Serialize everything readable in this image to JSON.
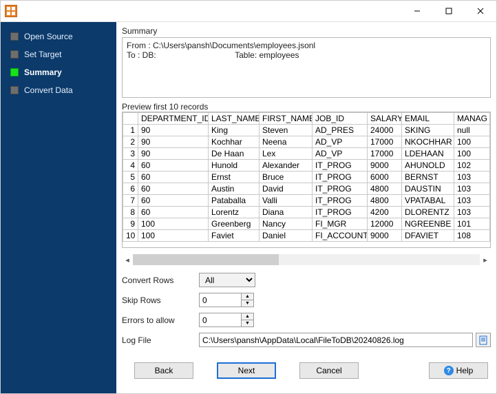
{
  "sidebar": {
    "items": [
      {
        "label": "Open Source",
        "active": false
      },
      {
        "label": "Set Target",
        "active": false
      },
      {
        "label": "Summary",
        "active": true
      },
      {
        "label": "Convert Data",
        "active": false
      }
    ]
  },
  "summary": {
    "section_label": "Summary",
    "from_line": "From : C:\\Users\\pansh\\Documents\\employees.jsonl",
    "to_label": "To : DB:",
    "table_label": "Table: employees"
  },
  "preview": {
    "label": "Preview first 10 records",
    "columns": [
      "DEPARTMENT_ID",
      "LAST_NAME",
      "FIRST_NAME",
      "JOB_ID",
      "SALARY",
      "EMAIL",
      "MANAG"
    ],
    "rows": [
      {
        "n": "1",
        "DEPARTMENT_ID": "90",
        "LAST_NAME": "King",
        "FIRST_NAME": "Steven",
        "JOB_ID": "AD_PRES",
        "SALARY": "24000",
        "EMAIL": "SKING",
        "MANAG": "null"
      },
      {
        "n": "2",
        "DEPARTMENT_ID": "90",
        "LAST_NAME": "Kochhar",
        "FIRST_NAME": "Neena",
        "JOB_ID": "AD_VP",
        "SALARY": "17000",
        "EMAIL": "NKOCHHAR",
        "MANAG": "100"
      },
      {
        "n": "3",
        "DEPARTMENT_ID": "90",
        "LAST_NAME": "De Haan",
        "FIRST_NAME": "Lex",
        "JOB_ID": "AD_VP",
        "SALARY": "17000",
        "EMAIL": "LDEHAAN",
        "MANAG": "100"
      },
      {
        "n": "4",
        "DEPARTMENT_ID": "60",
        "LAST_NAME": "Hunold",
        "FIRST_NAME": "Alexander",
        "JOB_ID": "IT_PROG",
        "SALARY": "9000",
        "EMAIL": "AHUNOLD",
        "MANAG": "102"
      },
      {
        "n": "5",
        "DEPARTMENT_ID": "60",
        "LAST_NAME": "Ernst",
        "FIRST_NAME": "Bruce",
        "JOB_ID": "IT_PROG",
        "SALARY": "6000",
        "EMAIL": "BERNST",
        "MANAG": "103"
      },
      {
        "n": "6",
        "DEPARTMENT_ID": "60",
        "LAST_NAME": "Austin",
        "FIRST_NAME": "David",
        "JOB_ID": "IT_PROG",
        "SALARY": "4800",
        "EMAIL": "DAUSTIN",
        "MANAG": "103"
      },
      {
        "n": "7",
        "DEPARTMENT_ID": "60",
        "LAST_NAME": "Pataballa",
        "FIRST_NAME": "Valli",
        "JOB_ID": "IT_PROG",
        "SALARY": "4800",
        "EMAIL": "VPATABAL",
        "MANAG": "103"
      },
      {
        "n": "8",
        "DEPARTMENT_ID": "60",
        "LAST_NAME": "Lorentz",
        "FIRST_NAME": "Diana",
        "JOB_ID": "IT_PROG",
        "SALARY": "4200",
        "EMAIL": "DLORENTZ",
        "MANAG": "103"
      },
      {
        "n": "9",
        "DEPARTMENT_ID": "100",
        "LAST_NAME": "Greenberg",
        "FIRST_NAME": "Nancy",
        "JOB_ID": "FI_MGR",
        "SALARY": "12000",
        "EMAIL": "NGREENBE",
        "MANAG": "101"
      },
      {
        "n": "10",
        "DEPARTMENT_ID": "100",
        "LAST_NAME": "Faviet",
        "FIRST_NAME": "Daniel",
        "JOB_ID": "FI_ACCOUNT",
        "SALARY": "9000",
        "EMAIL": "DFAVIET",
        "MANAG": "108"
      }
    ]
  },
  "form": {
    "convert_rows": {
      "label": "Convert Rows",
      "value": "All"
    },
    "skip_rows": {
      "label": "Skip Rows",
      "value": "0"
    },
    "errors_allow": {
      "label": "Errors to allow",
      "value": "0"
    },
    "log_file": {
      "label": "Log File",
      "value": "C:\\Users\\pansh\\AppData\\Local\\FileToDB\\20240826.log"
    }
  },
  "buttons": {
    "back": "Back",
    "next": "Next",
    "cancel": "Cancel",
    "help": "Help"
  }
}
